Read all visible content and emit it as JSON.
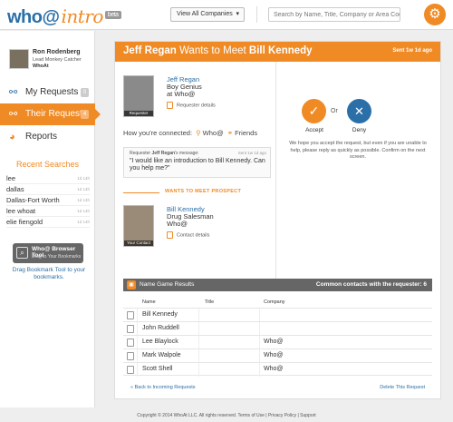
{
  "app": {
    "logo_main": "who@",
    "logo_sub": "intro",
    "logo_badge": "beta"
  },
  "topbar": {
    "company_select": "View All Companies",
    "search_placeholder": "Search by Name, Title, Company or Area Code"
  },
  "profile": {
    "name": "Ron Rodenberg",
    "title": "Lead Monkey Catcher",
    "company": "WhoAt"
  },
  "nav": {
    "my_requests": {
      "label": "My Requests",
      "count": "0"
    },
    "their_requests": {
      "label": "Their Requests",
      "count": "4"
    },
    "reports": {
      "label": "Reports"
    }
  },
  "recent_searches": {
    "title": "Recent Searches",
    "items": [
      {
        "term": "lee",
        "date": "1d 14h"
      },
      {
        "term": "dallas",
        "date": "1d 14h"
      },
      {
        "term": "Dallas-Fort Worth",
        "date": "1d 14h"
      },
      {
        "term": "lee whoat",
        "date": "1d 14h"
      },
      {
        "term": "elie fiengold",
        "date": "1d 14h"
      }
    ]
  },
  "bookmark_tool": {
    "title": "Who@ Browser Tool",
    "subtitle": "Drag to Your Bookmarks",
    "caption": "Drag Bookmark Tool to your bookmarks."
  },
  "request": {
    "header": {
      "requester": "Jeff Regan",
      "middle": " Wants to Meet ",
      "target": "Bill Kennedy",
      "sent": "Sent 1w 1d ago"
    },
    "requester": {
      "name": "Jeff Regan",
      "title": "Boy Genius",
      "company": "at Who@",
      "photo_label": "Requester",
      "details_link": "Requester details"
    },
    "connected": {
      "label": "How you're connected:",
      "via1": "Who@",
      "via2": "Friends"
    },
    "message": {
      "prefix": "Requester ",
      "sender": "Jeff Regan",
      "suffix": "'s message:",
      "date": "Sent 1w 1d ago",
      "text": "\"I would like an introduction to Bill Kennedy. Can you help me?\""
    },
    "wants_to_meet_label": "WANTS TO MEET PROSPECT",
    "prospect": {
      "name": "Bill Kennedy",
      "title": "Drug Salesman",
      "company": "Who@",
      "photo_label": "Your Contact",
      "details_link": "Contact details"
    },
    "actions": {
      "accept": "Accept",
      "or": "Or",
      "deny": "Deny",
      "help_text": "We hope you accept the request, but even if you are unable to help, please reply as quickly as possible. Confirm on the next screen."
    }
  },
  "name_game": {
    "title": "Name Game Results",
    "count_label": "Common contacts with the requester: 6",
    "columns": [
      "Name",
      "Title",
      "Company"
    ],
    "rows": [
      {
        "name": "Bill Kennedy",
        "title": "",
        "company": ""
      },
      {
        "name": "John Ruddell",
        "title": "",
        "company": ""
      },
      {
        "name": "Lee Blaylock",
        "title": "",
        "company": "Who@"
      },
      {
        "name": "Mark Walpole",
        "title": "",
        "company": "Who@"
      },
      {
        "name": "Scott Shell",
        "title": "",
        "company": "Who@"
      }
    ]
  },
  "links": {
    "back": "« Back to Incoming Requests",
    "delete": "Delete This Request"
  },
  "footer": "Copyright © 2014 WhoAt LLC. All rights reserved. Terms of Use | Privacy Policy | Support",
  "colors": {
    "brand_orange": "#f08a24",
    "brand_blue": "#2a6fa8"
  }
}
